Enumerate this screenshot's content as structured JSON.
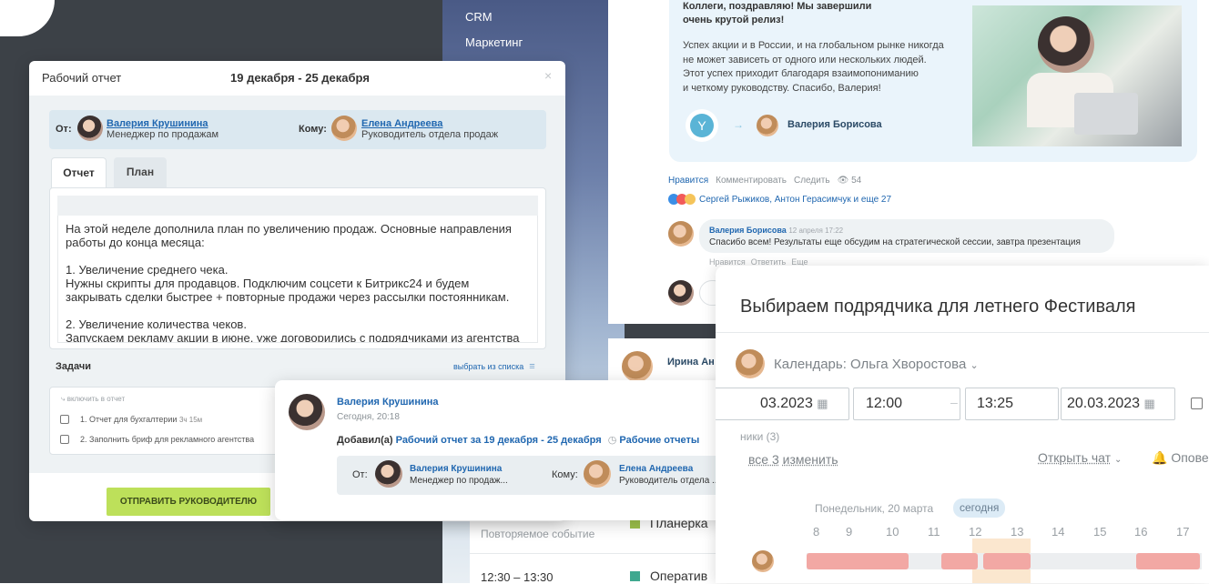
{
  "nav": {
    "crm": "CRM",
    "marketing": "Маркетинг"
  },
  "report": {
    "title": "Рабочий отчет",
    "period": "19 декабря - 25 декабря",
    "close": "×",
    "from_label": "От:",
    "from_name": "Валерия Крушинина",
    "from_role": "Менеджер по продажам",
    "to_label": "Кому:",
    "to_name": "Елена Андреева",
    "to_role": "Руководитель отдела продаж",
    "tabs": [
      "Отчет",
      "План"
    ],
    "text_lines": [
      "На этой неделе дополнила план по увеличению продаж. Основные направления",
      "работы до конца месяца:",
      "",
      "1. Увеличение среднего чека.",
      "Нужны скрипты для продавцов. Подключим соцсети к Битрикс24 и будем",
      "закрывать сделки быстрее + повторные продажи через рассылки постоянникам.",
      "",
      "2. Увеличение количества чеков.",
      "Запускаем рекламу акции в июне, уже договорились с подрядчиками из агентства"
    ],
    "tasks_label": "Задачи",
    "choose_link": "выбрать из списка",
    "include_label": "включить в отчет",
    "tasks": [
      {
        "name": "1. Отчет для бухгалтерии",
        "time": "3ч 15м"
      },
      {
        "name": "2. Заполнить бриф для рекламного агентства",
        "time": ""
      }
    ],
    "send_button": "ОТПРАВИТЬ РУКОВОДИТЕЛЮ"
  },
  "feed_post": {
    "text_line1": "Коллеги, поздравляю! Мы завершили",
    "text_line2": "очень крутой релиз!",
    "body": [
      "Успех акции и в России, и на глобальном рынке никогда",
      "не может зависеть от одного или нескольких людей.",
      "Этот успех приходит благодаря взаимопониманию",
      "и четкому руководству. Спасибо, Валерия!"
    ],
    "recipient": "Валерия Борисова",
    "actions": [
      "Нравится",
      "Комментировать",
      "Следить"
    ],
    "views": "54",
    "likes_text": "Сергей Рыжиков, Антон Герасимчук и еще 27",
    "comment_author": "Валерия Борисова",
    "comment_date": "12 апреля 17:22",
    "comment_text": "Спасибо всем! Результаты еще обсудим на стратегической сессии, завтра презентация",
    "comment_actions": [
      "Нравится",
      "Ответить",
      "Еще"
    ],
    "next_author": "Ирина Ан"
  },
  "notice": {
    "author": "Валерия Крушинина",
    "time": "Сегодня, 20:18",
    "added": "Добавил(а)",
    "report_link": "Рабочий отчет за 19 декабря - 25 декабря",
    "reports_link": "Рабочие отчеты",
    "from_label": "От:",
    "from_name": "Валерия Крушинина",
    "from_role": "Менеджер по продаж...",
    "to_label": "Кому:",
    "to_name": "Елена Андреева",
    "to_role": "Руководитель отдела ..."
  },
  "calendar_list": {
    "repeat": "Повторяемое событие",
    "planerka": "Планерка",
    "time": "12:30 – 13:30",
    "operative": "Оператив"
  },
  "event": {
    "title": "Выбираем подрядчика для летнего Фестиваля",
    "calendar": "Календарь: Ольга Хворостова",
    "date_from": "03.2023",
    "time_from": "12:00",
    "time_to": "13:25",
    "date_to": "20.03.2023",
    "participants_label": "ники (3)",
    "all_change": "все 3",
    "change": "изменить",
    "open_chat": "Открыть чат",
    "notify": "Опове",
    "day_label": "Понедельник, 20 марта",
    "today": "сегодня",
    "hours": [
      "8",
      "9",
      "10",
      "11",
      "12",
      "13",
      "14",
      "15",
      "16",
      "17"
    ]
  }
}
